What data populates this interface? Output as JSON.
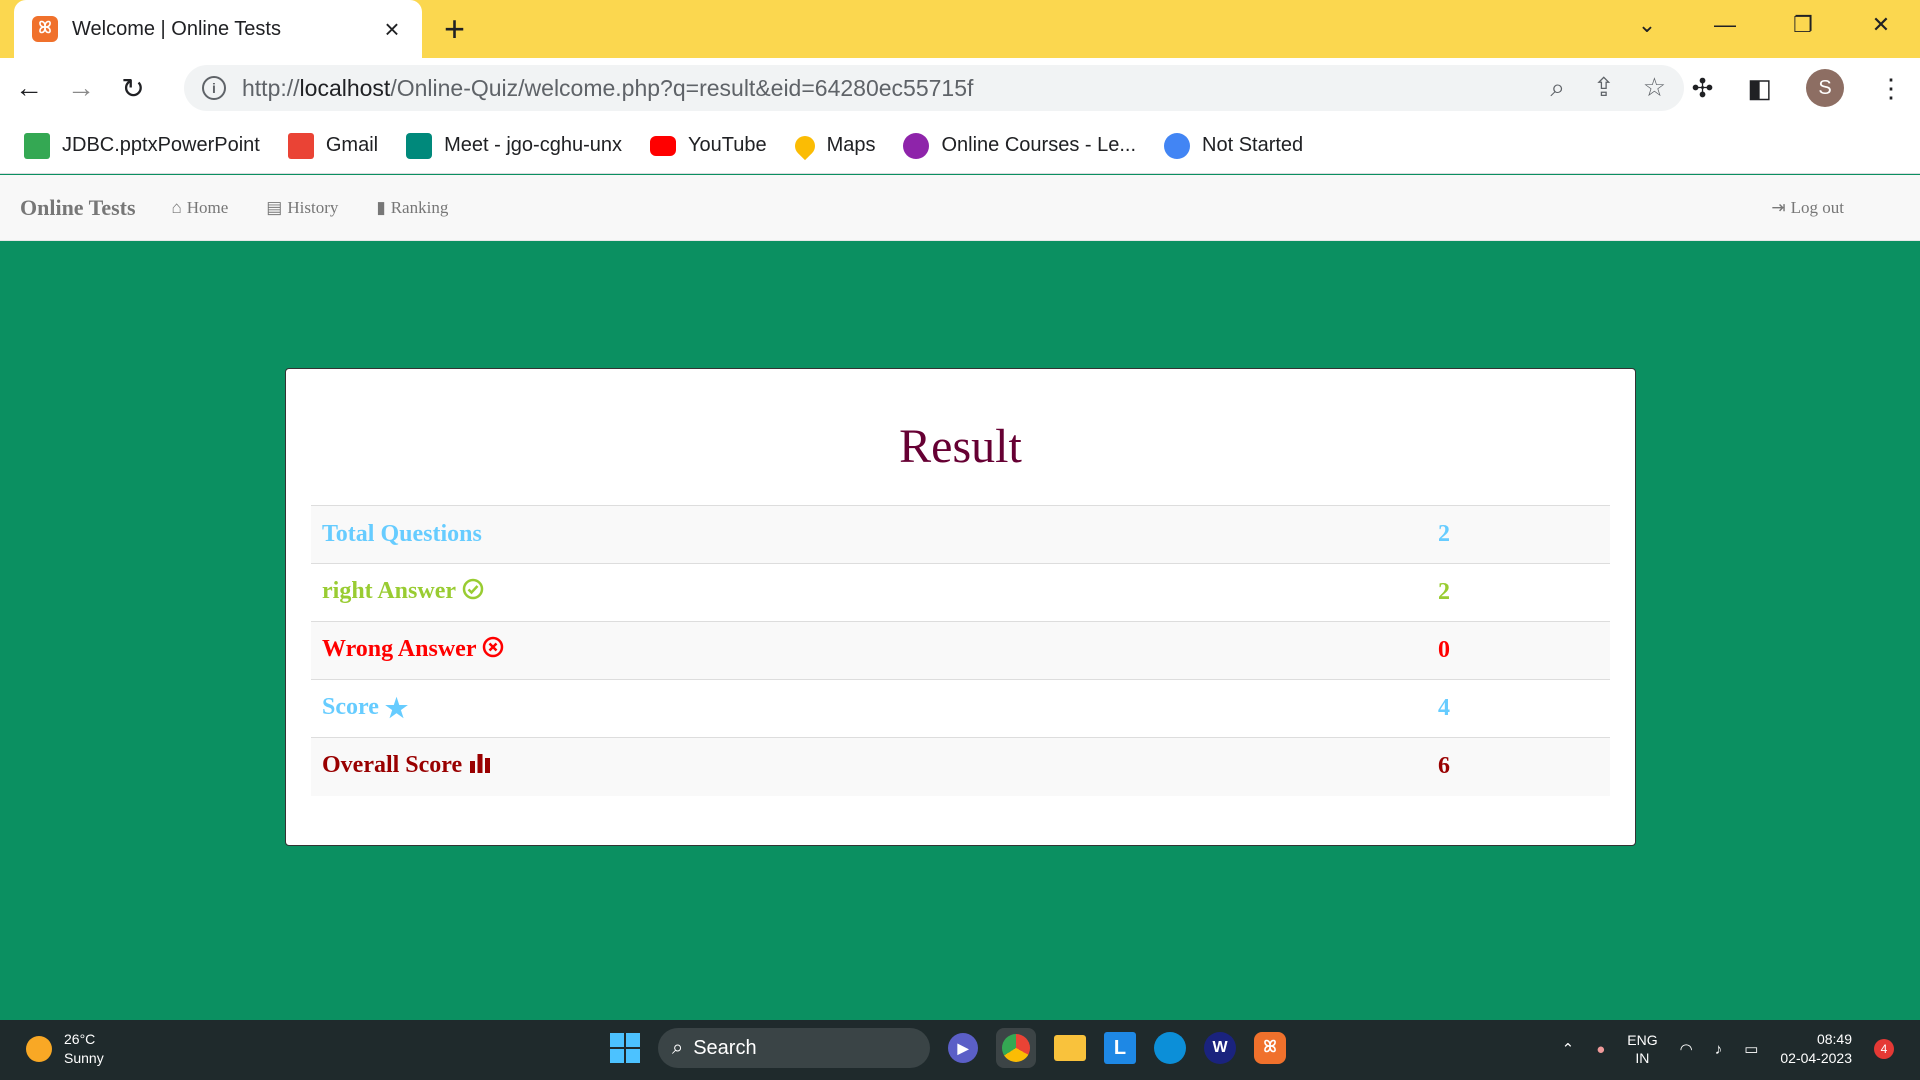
{
  "browser": {
    "tab_title": "Welcome | Online Tests",
    "url_prefix": "http://",
    "url_host": "localhost",
    "url_path": "/Online-Quiz/welcome.php?q=result&eid=64280ec55715f",
    "avatar_letter": "S"
  },
  "bookmarks": [
    {
      "label": "JDBC.pptxPowerPoint",
      "color": "#34a853"
    },
    {
      "label": "Gmail",
      "color": "#ea4335"
    },
    {
      "label": "Meet - jgo-cghu-unx",
      "color": "#00897b"
    },
    {
      "label": "YouTube",
      "color": "#ff0000"
    },
    {
      "label": "Maps",
      "color": "#fbbc04"
    },
    {
      "label": "Online Courses - Le...",
      "color": "#8e24aa"
    },
    {
      "label": "Not Started",
      "color": "#4285f4"
    }
  ],
  "navbar": {
    "brand": "Online Tests",
    "home": "Home",
    "history": "History",
    "ranking": "Ranking",
    "logout": "Log out"
  },
  "result": {
    "title": "Result",
    "rows": [
      {
        "label": "Total Questions",
        "value": "2",
        "color": "#66ccff",
        "icon": ""
      },
      {
        "label": "right Answer",
        "value": "2",
        "color": "#99cc32",
        "icon": "check-circle-icon"
      },
      {
        "label": "Wrong Answer",
        "value": "0",
        "color": "#ff0000",
        "icon": "remove-circle-icon"
      },
      {
        "label": "Score",
        "value": "4",
        "color": "#66ccff",
        "icon": "star-icon"
      },
      {
        "label": "Overall Score",
        "value": "6",
        "color": "#990000",
        "icon": "bar-chart-icon"
      }
    ]
  },
  "taskbar": {
    "temperature": "26°C",
    "weather": "Sunny",
    "search": "Search",
    "lang1": "ENG",
    "lang2": "IN",
    "time": "08:49",
    "date": "02-04-2023",
    "notifications": "4"
  }
}
